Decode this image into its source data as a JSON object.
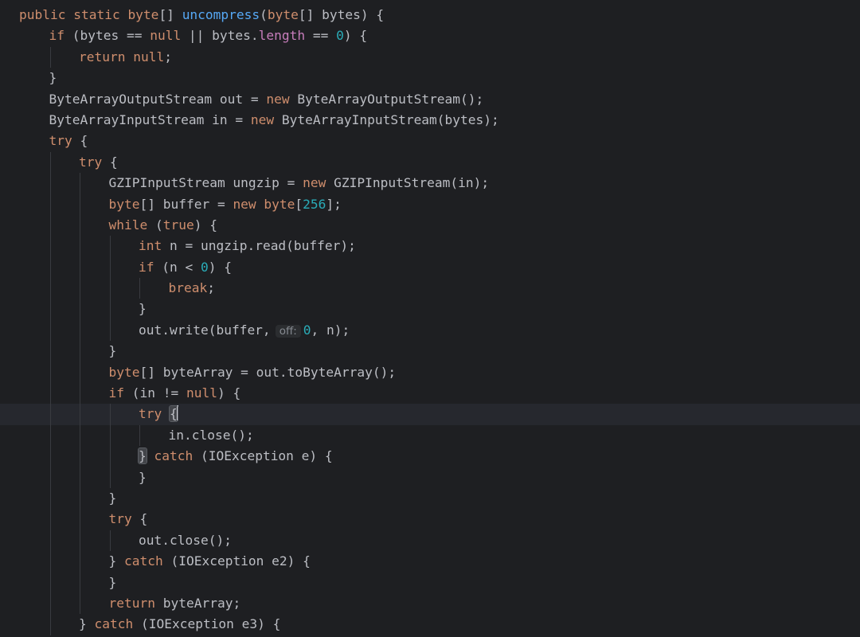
{
  "editor": {
    "theme": {
      "background": "#1e1f22",
      "text": "#bcbec4",
      "keyword": "#cf8e6d",
      "function": "#56a8f5",
      "field": "#c77dbb",
      "number": "#2aacb8",
      "current_line": "#26282e"
    },
    "current_line_index": 19,
    "lines": [
      {
        "indent": 0,
        "tokens": [
          [
            "kw",
            "public static byte"
          ],
          [
            "pl",
            "[] "
          ],
          [
            "fn",
            "uncompress"
          ],
          [
            "pl",
            "("
          ],
          [
            "kw",
            "byte"
          ],
          [
            "pl",
            "[] bytes) {"
          ]
        ]
      },
      {
        "indent": 1,
        "tokens": [
          [
            "kw",
            "if"
          ],
          [
            "pl",
            " (bytes == "
          ],
          [
            "kw",
            "null"
          ],
          [
            "pl",
            " || bytes."
          ],
          [
            "fld",
            "length"
          ],
          [
            "pl",
            " == "
          ],
          [
            "num",
            "0"
          ],
          [
            "pl",
            ") {"
          ]
        ]
      },
      {
        "indent": 2,
        "tokens": [
          [
            "kw",
            "return null"
          ],
          [
            "pl",
            ";"
          ]
        ]
      },
      {
        "indent": 1,
        "tokens": [
          [
            "pl",
            "}"
          ]
        ]
      },
      {
        "indent": 1,
        "tokens": [
          [
            "pl",
            "ByteArrayOutputStream out = "
          ],
          [
            "kw",
            "new"
          ],
          [
            "pl",
            " ByteArrayOutputStream();"
          ]
        ]
      },
      {
        "indent": 1,
        "tokens": [
          [
            "pl",
            "ByteArrayInputStream in = "
          ],
          [
            "kw",
            "new"
          ],
          [
            "pl",
            " ByteArrayInputStream(bytes);"
          ]
        ]
      },
      {
        "indent": 1,
        "tokens": [
          [
            "kw",
            "try"
          ],
          [
            "pl",
            " {"
          ]
        ]
      },
      {
        "indent": 2,
        "tokens": [
          [
            "kw",
            "try"
          ],
          [
            "pl",
            " {"
          ]
        ]
      },
      {
        "indent": 3,
        "tokens": [
          [
            "pl",
            "GZIPInputStream ungzip = "
          ],
          [
            "kw",
            "new"
          ],
          [
            "pl",
            " GZIPInputStream(in);"
          ]
        ]
      },
      {
        "indent": 3,
        "tokens": [
          [
            "kw",
            "byte"
          ],
          [
            "pl",
            "[] buffer = "
          ],
          [
            "kw",
            "new byte"
          ],
          [
            "pl",
            "["
          ],
          [
            "num",
            "256"
          ],
          [
            "pl",
            "];"
          ]
        ]
      },
      {
        "indent": 3,
        "tokens": [
          [
            "kw",
            "while"
          ],
          [
            "pl",
            " ("
          ],
          [
            "kw",
            "true"
          ],
          [
            "pl",
            ") {"
          ]
        ]
      },
      {
        "indent": 4,
        "tokens": [
          [
            "kw",
            "int"
          ],
          [
            "pl",
            " n = ungzip.read(buffer);"
          ]
        ]
      },
      {
        "indent": 4,
        "tokens": [
          [
            "kw",
            "if"
          ],
          [
            "pl",
            " (n < "
          ],
          [
            "num",
            "0"
          ],
          [
            "pl",
            ") {"
          ]
        ]
      },
      {
        "indent": 5,
        "tokens": [
          [
            "kw",
            "break"
          ],
          [
            "pl",
            ";"
          ]
        ]
      },
      {
        "indent": 4,
        "tokens": [
          [
            "pl",
            "}"
          ]
        ]
      },
      {
        "indent": 4,
        "tokens": [
          [
            "pl",
            "out.write(buffer,"
          ],
          [
            "hint",
            "off:"
          ],
          [
            "num",
            "0"
          ],
          [
            "pl",
            ", n);"
          ]
        ]
      },
      {
        "indent": 3,
        "tokens": [
          [
            "pl",
            "}"
          ]
        ]
      },
      {
        "indent": 3,
        "tokens": [
          [
            "kw",
            "byte"
          ],
          [
            "pl",
            "[] byteArray = out.toByteArray();"
          ]
        ]
      },
      {
        "indent": 3,
        "tokens": [
          [
            "kw",
            "if"
          ],
          [
            "pl",
            " (in != "
          ],
          [
            "kw",
            "null"
          ],
          [
            "pl",
            ") {"
          ]
        ]
      },
      {
        "indent": 4,
        "tokens": [
          [
            "kw",
            "try"
          ],
          [
            "pl",
            " "
          ],
          [
            "bracehl",
            "{"
          ],
          [
            "caret",
            ""
          ]
        ]
      },
      {
        "indent": 5,
        "tokens": [
          [
            "pl",
            "in.close();"
          ]
        ]
      },
      {
        "indent": 4,
        "tokens": [
          [
            "bracehl",
            "}"
          ],
          [
            "pl",
            " "
          ],
          [
            "kw",
            "catch"
          ],
          [
            "pl",
            " (IOException e) {"
          ]
        ]
      },
      {
        "indent": 4,
        "tokens": [
          [
            "pl",
            "}"
          ]
        ]
      },
      {
        "indent": 3,
        "tokens": [
          [
            "pl",
            "}"
          ]
        ]
      },
      {
        "indent": 3,
        "tokens": [
          [
            "kw",
            "try"
          ],
          [
            "pl",
            " {"
          ]
        ]
      },
      {
        "indent": 4,
        "tokens": [
          [
            "pl",
            "out.close();"
          ]
        ]
      },
      {
        "indent": 3,
        "tokens": [
          [
            "pl",
            "} "
          ],
          [
            "kw",
            "catch"
          ],
          [
            "pl",
            " (IOException e2) {"
          ]
        ]
      },
      {
        "indent": 3,
        "tokens": [
          [
            "pl",
            "}"
          ]
        ]
      },
      {
        "indent": 3,
        "tokens": [
          [
            "kw",
            "return"
          ],
          [
            "pl",
            " byteArray;"
          ]
        ]
      },
      {
        "indent": 2,
        "tokens": [
          [
            "pl",
            "} "
          ],
          [
            "kw",
            "catch"
          ],
          [
            "pl",
            " (IOException e3) {"
          ]
        ]
      }
    ]
  }
}
